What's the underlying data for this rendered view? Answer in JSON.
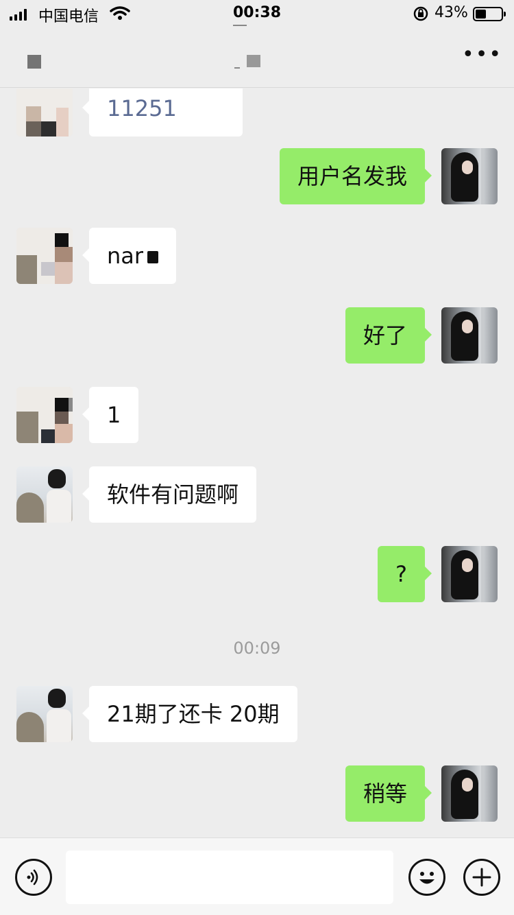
{
  "status_bar": {
    "carrier": "中国电信",
    "time": "00:38",
    "battery": "43%",
    "battery_level": 0.43
  },
  "nav": {
    "more_icon": "more-icon"
  },
  "messages": [
    {
      "side": "left",
      "avatar": "pixelated",
      "text": "11251"
    },
    {
      "side": "right",
      "avatar": "her",
      "text": "用户名发我"
    },
    {
      "side": "left",
      "avatar": "pixelated",
      "text": "nar"
    },
    {
      "side": "right",
      "avatar": "her",
      "text": "好了"
    },
    {
      "side": "left",
      "avatar": "pixelated",
      "text": "1"
    },
    {
      "side": "left",
      "avatar": "him",
      "text": "软件有问题啊"
    },
    {
      "side": "right",
      "avatar": "her",
      "text": "?"
    },
    {
      "side": "left",
      "avatar": "him",
      "text": "21期了还卡 20期"
    },
    {
      "side": "right",
      "avatar": "her",
      "text": "稍等"
    }
  ],
  "timestamp": "00:09",
  "colors": {
    "background": "#ededed",
    "self_bubble": "#95ec69",
    "other_bubble": "#ffffff",
    "timestamp": "#9b9b9b"
  },
  "input_bar": {
    "voice_icon": "voice-icon",
    "emoji_icon": "emoji-icon",
    "plus_icon": "plus-icon"
  }
}
